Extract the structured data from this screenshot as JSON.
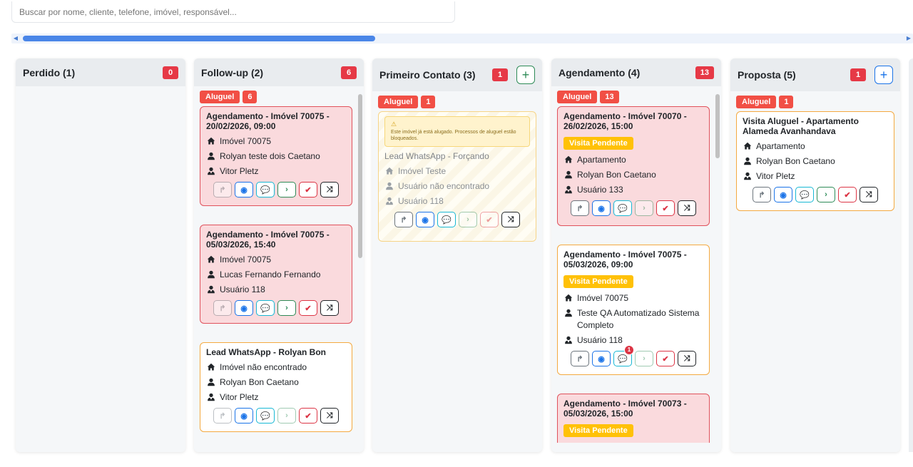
{
  "search": {
    "placeholder": "Buscar por nome, cliente, telefone, imóvel, responsável..."
  },
  "colors": {
    "accent": "#1a73e8",
    "danger": "#e63946",
    "tag": "#f14f45",
    "warning": "#ffc107",
    "card_red_bg": "#fadadd",
    "card_orange_border": "#f4a940"
  },
  "icons": {
    "property": "home-icon",
    "client": "user-icon",
    "responsible": "user-tie-icon",
    "share": "share-icon",
    "view": "eye-icon",
    "chat": "comments-icon",
    "next": "chevron-right-icon",
    "done": "check-icon",
    "move": "shuffle-icon",
    "add": "plus-icon",
    "warning": "warning-icon"
  },
  "columns": [
    {
      "title": "Perdido (1)",
      "count": "0"
    },
    {
      "title": "Follow-up (2)",
      "count": "6",
      "group": {
        "tag": "Aluguel",
        "count": "6"
      },
      "cards": [
        {
          "title": "Agendamento - Imóvel 70075 - 20/02/2026, 09:00",
          "property": "Imóvel 70075",
          "client": "Rolyan teste dois Caetano",
          "responsible": "Vitor Pletz"
        },
        {
          "title": "Agendamento - Imóvel 70075 - 05/03/2026, 15:40",
          "property": "Imóvel 70075",
          "client": "Lucas Fernando Fernando",
          "responsible": "Usuário 118"
        },
        {
          "title": "Lead WhatsApp - Rolyan Bon",
          "property": "Imóvel não encontrado",
          "client": "Rolyan Bon Caetano",
          "responsible": "Vitor Pletz"
        }
      ]
    },
    {
      "title": "Primeiro Contato (3)",
      "count": "1",
      "add": "+",
      "group": {
        "tag": "Aluguel",
        "count": "1"
      },
      "cards": [
        {
          "notice_icon": "⚠",
          "notice": "Este imóvel já está alugado. Processos de aluguel estão bloqueados.",
          "title": "Lead WhatsApp - Forçando",
          "property": "Imóvel Teste",
          "client": "Usuário não encontrado",
          "responsible": "Usuário 118"
        }
      ]
    },
    {
      "title": "Agendamento (4)",
      "count": "13",
      "group": {
        "tag": "Aluguel",
        "count": "13"
      },
      "cards": [
        {
          "title": "Agendamento - Imóvel 70070 - 26/02/2026, 15:00",
          "status": "Visita Pendente",
          "property": "Apartamento",
          "client": "Rolyan Bon Caetano",
          "responsible": "Usuário 133"
        },
        {
          "title": "Agendamento - Imóvel 70075 - 05/03/2026, 09:00",
          "status": "Visita Pendente",
          "property": "Imóvel 70075",
          "client": "Teste QA Automatizado Sistema Completo",
          "responsible": "Usuário 118",
          "chat_badge": "1"
        },
        {
          "title": "Agendamento - Imóvel 70073 - 05/03/2026, 15:00",
          "status": "Visita Pendente"
        }
      ]
    },
    {
      "title": "Proposta (5)",
      "count": "1",
      "add": "+",
      "group": {
        "tag": "Aluguel",
        "count": "1"
      },
      "cards": [
        {
          "title": "Visita Aluguel - Apartamento Alameda Avanhandava",
          "property": "Apartamento",
          "client": "Rolyan Bon Caetano",
          "responsible": "Vitor Pletz"
        }
      ]
    }
  ]
}
